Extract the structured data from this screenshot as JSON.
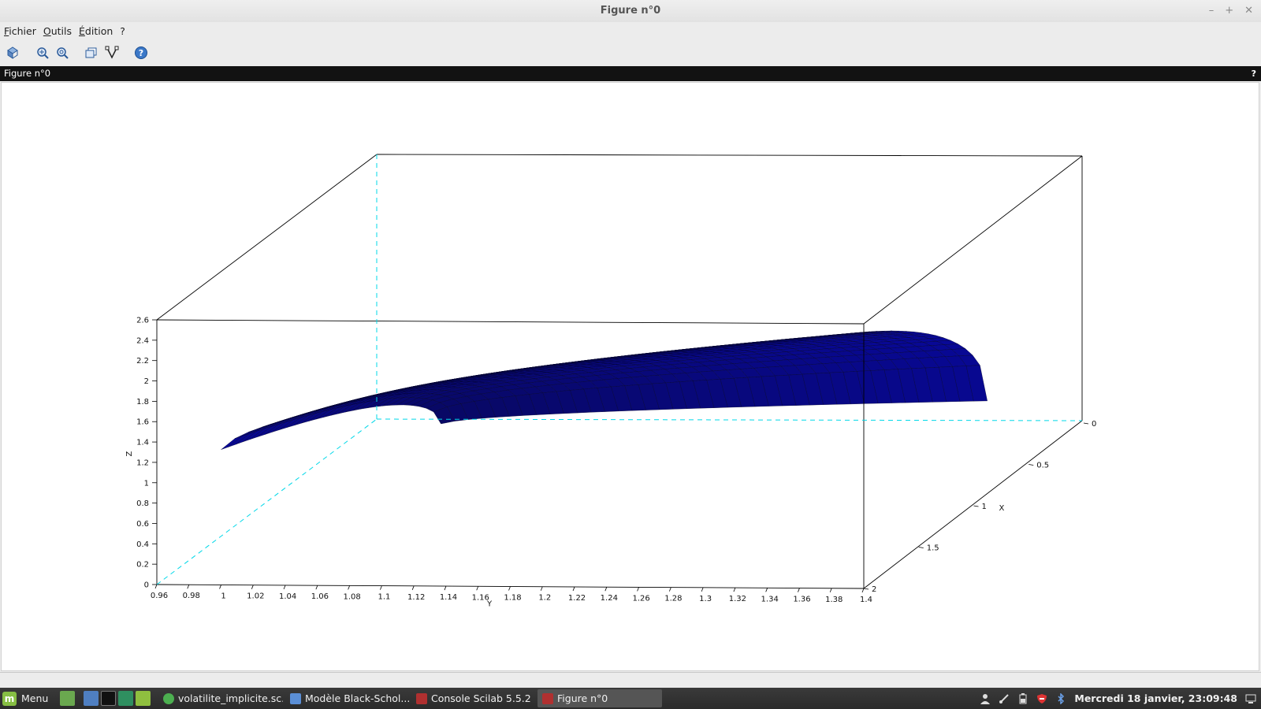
{
  "window": {
    "title": "Figure n°0",
    "controls": [
      "–",
      "+",
      "✕"
    ]
  },
  "menubar": {
    "items": [
      "Fichier",
      "Outils",
      "Édition",
      "?"
    ]
  },
  "toolbar": {
    "icons": [
      "rotate-icon",
      "zoom-icon",
      "zoom-reset-icon",
      "new-window-icon",
      "datatip-icon",
      "help-icon"
    ]
  },
  "dock": {
    "title": "Figure n°0",
    "help": "?"
  },
  "figure": {
    "z_axis": {
      "label": "Z",
      "ticks": [
        "0",
        "0.2",
        "0.4",
        "0.6",
        "0.8",
        "1",
        "1.2",
        "1.4",
        "1.6",
        "1.8",
        "2",
        "2.2",
        "2.4",
        "2.6"
      ]
    },
    "y_axis": {
      "label": "Y",
      "ticks": [
        "0.96",
        "0.98",
        "1",
        "1.02",
        "1.04",
        "1.06",
        "1.08",
        "1.1",
        "1.12",
        "1.14",
        "1.16",
        "1.18",
        "1.2",
        "1.22",
        "1.24",
        "1.26",
        "1.28",
        "1.3",
        "1.32",
        "1.34",
        "1.36",
        "1.38",
        "1.4"
      ]
    },
    "x_axis": {
      "label": "X",
      "ticks": [
        "0",
        "0.5",
        "1",
        "1.5",
        "2"
      ]
    },
    "surface_color": "#0a0ab4",
    "hidden_axis_color": "#00d8e8"
  },
  "taskbar": {
    "menu_label": "Menu",
    "tasks": [
      {
        "label": "volatilite_implicite.sc...",
        "icon_color": "#4caf50",
        "active": false
      },
      {
        "label": "Modèle Black-Schol...",
        "icon_color": "#5b8fd6",
        "active": false
      },
      {
        "label": "Console Scilab 5.5.2",
        "icon_color": "#b03030",
        "active": false
      },
      {
        "label": "Figure n°0",
        "icon_color": "#b03030",
        "active": true
      }
    ],
    "clock": "Mercredi 18 janvier, 23:09:48"
  }
}
